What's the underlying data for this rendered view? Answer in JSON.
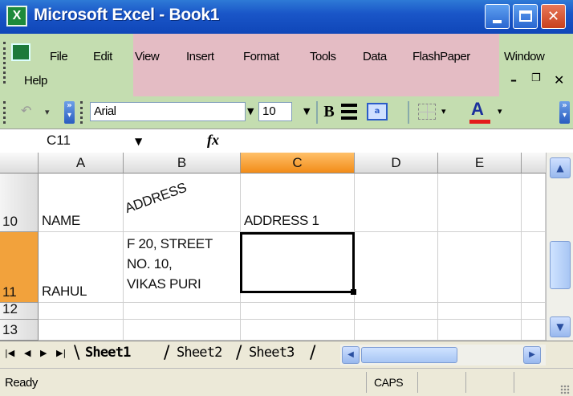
{
  "window": {
    "title": "Microsoft Excel - Book1"
  },
  "menu": {
    "items": [
      "File",
      "Edit",
      "View",
      "Insert",
      "Format",
      "Tools",
      "Data",
      "FlashPaper",
      "Window",
      "Help"
    ]
  },
  "toolbar": {
    "font_name": "Arial",
    "font_size": "10",
    "bold_label": "B",
    "font_color": "#e41b1b"
  },
  "formula_bar": {
    "name_box": "C11",
    "fx_label": "fx",
    "content": ""
  },
  "grid": {
    "columns": [
      "A",
      "B",
      "C",
      "D",
      "E"
    ],
    "active_column": "C",
    "rows": [
      {
        "num": "10",
        "A": "NAME",
        "B": "ADDRESS",
        "C": "ADDRESS 1",
        "D": "",
        "E": ""
      },
      {
        "num": "11",
        "A": "RAHUL",
        "B": "F 20, STREET\nNO. 10,\nVIKAS PURI",
        "C": "",
        "D": "",
        "E": ""
      },
      {
        "num": "12",
        "A": "",
        "B": "",
        "C": "",
        "D": "",
        "E": ""
      },
      {
        "num": "13",
        "A": "",
        "B": "",
        "C": "",
        "D": "",
        "E": ""
      }
    ],
    "selected_cell": "C11"
  },
  "sheets": {
    "tabs": [
      "Sheet1",
      "Sheet2",
      "Sheet3"
    ],
    "active": "Sheet1"
  },
  "status": {
    "mode": "Ready",
    "caps": "CAPS"
  },
  "icons": {
    "app": "excel-icon",
    "undo": "undo-icon",
    "bold": "bold-icon",
    "align": "align-center-icon",
    "merge": "merge-center-icon",
    "borders": "borders-icon",
    "font_color": "font-color-icon"
  }
}
